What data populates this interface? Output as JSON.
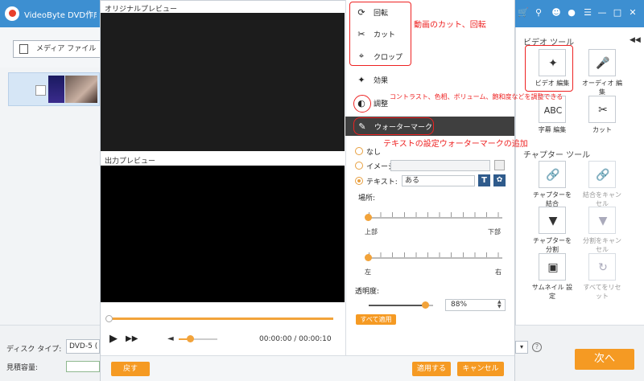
{
  "app": {
    "title": "VideoByte DVD作成 (",
    "add_media_label": "メディア ファイル",
    "disc_type_label": "ディスク タイプ:",
    "disc_type_value": "DVD-5 (",
    "capacity_label": "見積容量:",
    "next_label": "次へ"
  },
  "editor": {
    "original_preview_label": "オリジナルプレビュー",
    "output_preview_label": "出力プレビュー",
    "time_display": "00:00:00 / 00:00:10",
    "menu": {
      "rotate": "回転",
      "cut": "カット",
      "crop": "クロップ",
      "effect": "効果",
      "adjust": "調整",
      "watermark": "ウォーターマーク"
    },
    "watermark": {
      "none_label": "なし",
      "image_label": "イメージ:",
      "text_label": "テキスト:",
      "text_value": "ある",
      "text_style_glyph": "T",
      "position_label": "場所:",
      "top_label": "上部",
      "bottom_label": "下部",
      "left_label": "左",
      "right_label": "右",
      "opacity_label": "透明度:",
      "opacity_value": "88%",
      "opacity_fraction": 0.88,
      "apply_all_label": "すべて適用"
    },
    "footer": {
      "back_label": "戻す",
      "apply_label": "適用する",
      "cancel_label": "キャンセル"
    }
  },
  "right_panel": {
    "video_tools_title": "ビデオ ツール",
    "video_edit_label": "ビデオ 編集",
    "audio_edit_label": "オーディオ 編集",
    "subtitle_glyph": "ABC",
    "subtitle_edit_label": "字幕 編集",
    "cut_label": "カット",
    "chapter_tools_title": "チャプター ツール",
    "merge_chapter_label": "チャプターを結合",
    "unmerge_label": "結合をキャンセル",
    "split_chapter_label": "チャプターを分割",
    "unsplit_label": "分割をキャンセル",
    "thumbnail_label": "サムネイル 設定",
    "reset_all_label": "すべてをリセット"
  },
  "annotations": {
    "cut_rotate": "動画のカット、回転",
    "adjust_desc": "コントラスト、色相、ボリューム、飽和度などを調整できる",
    "watermark_desc": "テキストの設定ウォーターマークの追加"
  },
  "colors": {
    "accent_orange": "#f59a23",
    "titlebar_blue": "#3d8fd1",
    "annotation_red": "#e22"
  },
  "icons": {
    "rotate": "rotate-icon",
    "cut": "scissors-icon",
    "crop": "crop-icon",
    "effect": "sparkle-icon",
    "adjust": "adjust-icon",
    "watermark": "brush-icon"
  }
}
